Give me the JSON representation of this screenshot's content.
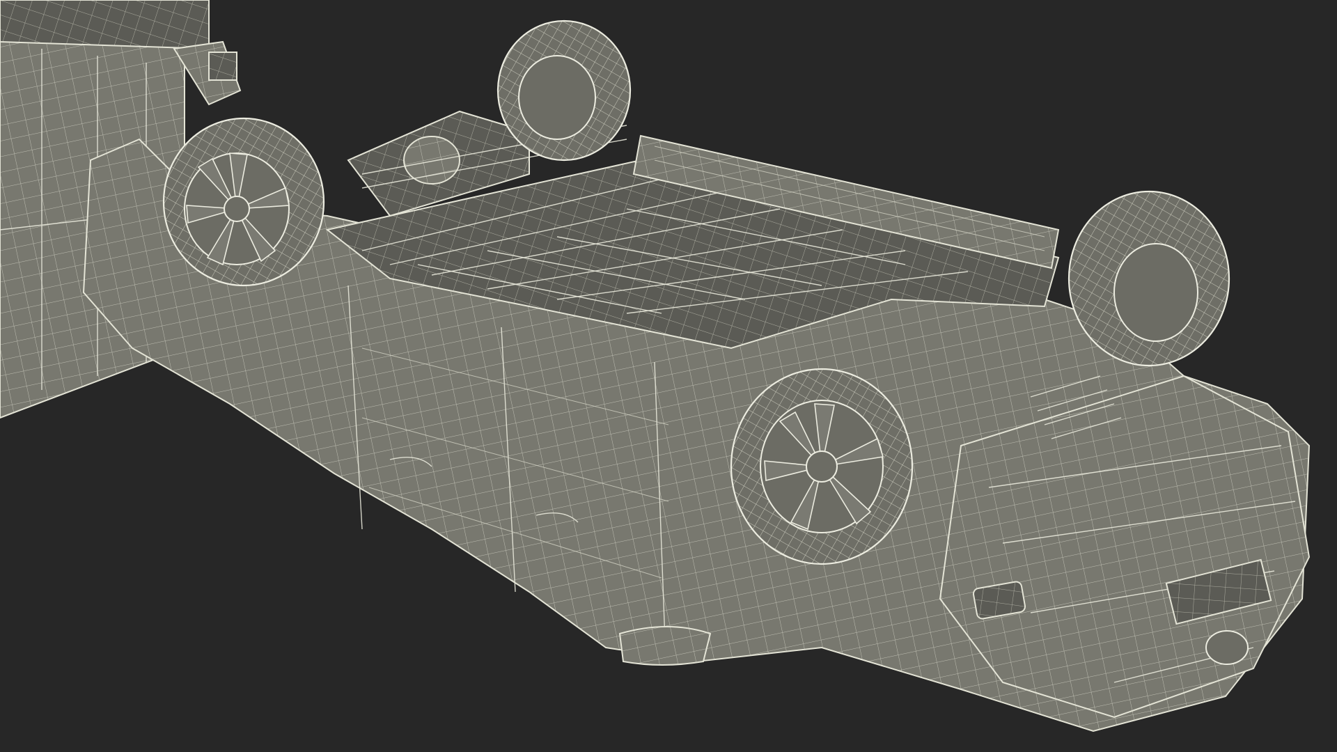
{
  "scene": {
    "subject": "wireframe-3d-model-overturned-vehicle",
    "colors": {
      "background": "#272727",
      "surface": "#76766e",
      "surface_dark": "#55554f",
      "wire": "#e4e4d6"
    }
  }
}
